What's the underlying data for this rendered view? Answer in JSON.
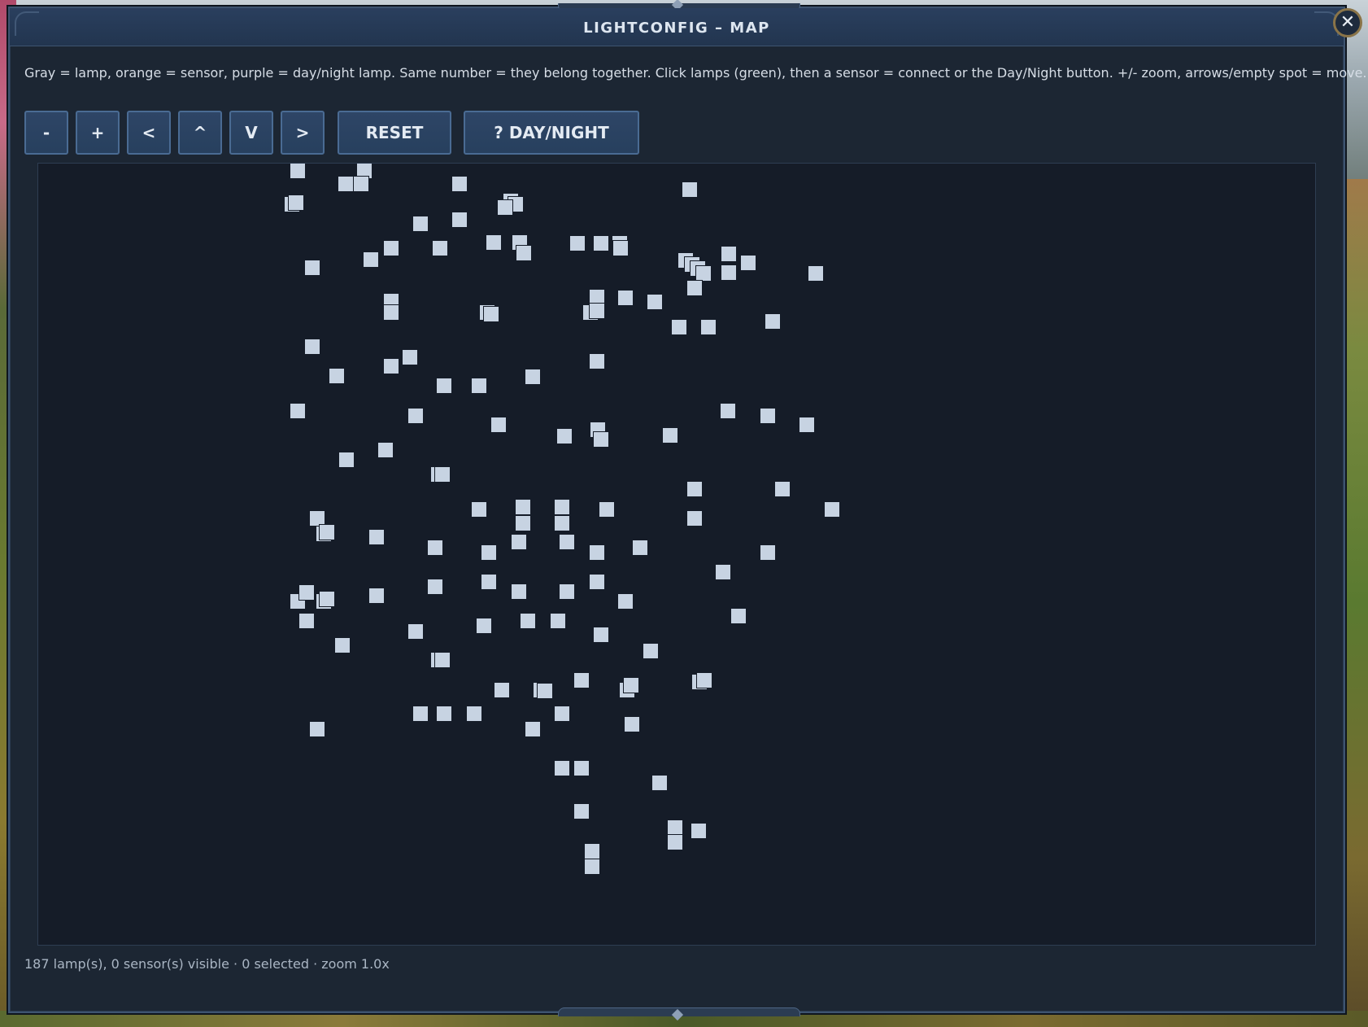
{
  "window": {
    "title": "LIGHTCONFIG – MAP",
    "close_label": "✕"
  },
  "instructions": "Gray = lamp, orange = sensor, purple = day/night lamp. Same number = they belong together. Click lamps (green), then a sensor = connect or the Day/Night button. +/- zoom, arrows/empty spot = move.",
  "toolbar": {
    "zoom_out_label": "-",
    "zoom_in_label": "+",
    "left_label": "<",
    "up_label": "^",
    "down_label": "V",
    "right_label": ">",
    "reset_label": "RESET",
    "daynight_label": "? DAY/NIGHT"
  },
  "colors": {
    "lamp": "#c7d3e2",
    "map_background": "#151c28",
    "panel": "#1c2633",
    "button": "#2e4566",
    "sensor": "orange",
    "daynight_lamp": "purple",
    "selected_lamp": "green"
  },
  "status": "187 lamp(s), 0 sensor(s) visible · 0 selected · zoom 1.0x"
}
